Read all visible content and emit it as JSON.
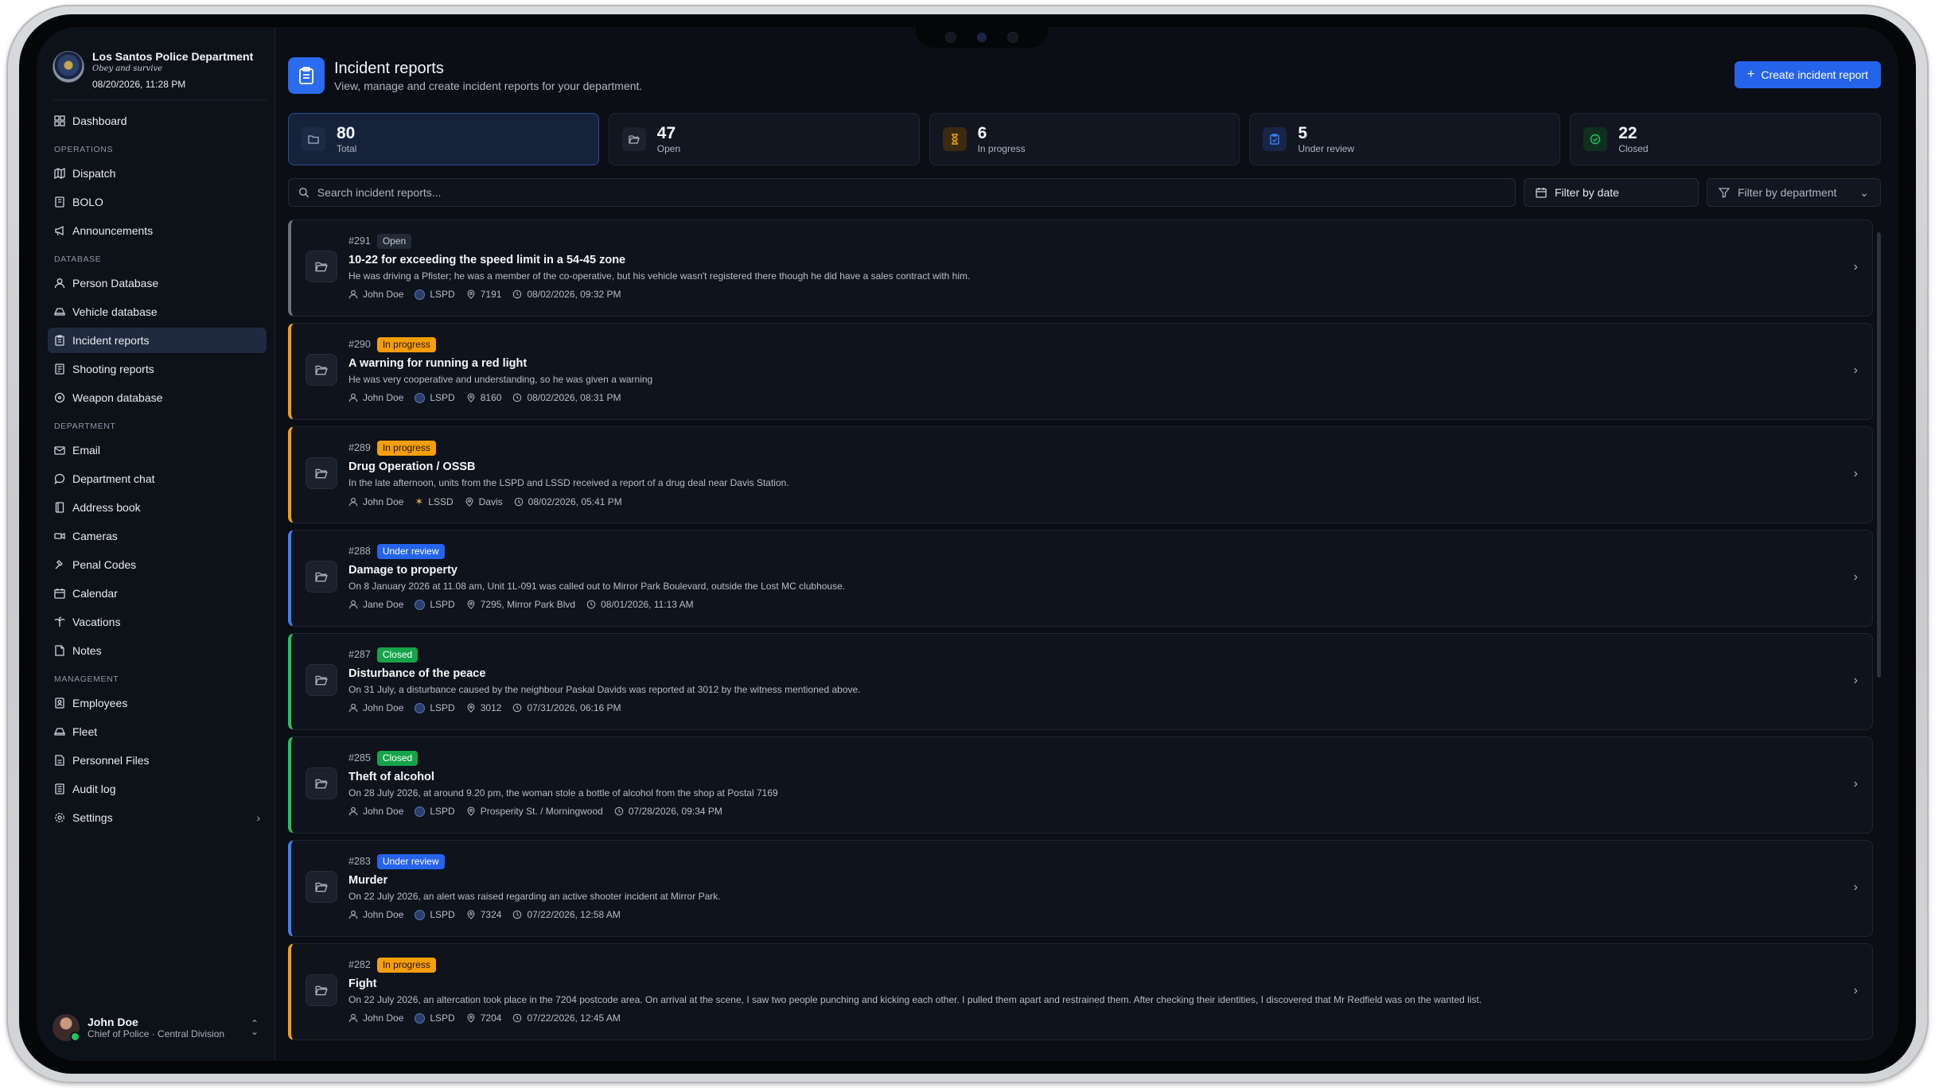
{
  "org": {
    "name": "Los Santos Police Department",
    "motto": "Obey and survive",
    "datetime": "08/20/2026, 11:28 PM"
  },
  "nav": {
    "dashboard": "Dashboard",
    "sections": {
      "operations": "OPERATIONS",
      "database": "DATABASE",
      "department": "DEPARTMENT",
      "management": "MANAGEMENT"
    },
    "operations": [
      "Dispatch",
      "BOLO",
      "Announcements"
    ],
    "database": [
      "Person Database",
      "Vehicle database",
      "Incident reports",
      "Shooting reports",
      "Weapon database"
    ],
    "department": [
      "Email",
      "Department chat",
      "Address book",
      "Cameras",
      "Penal Codes",
      "Calendar",
      "Vacations",
      "Notes"
    ],
    "management": [
      "Employees",
      "Fleet",
      "Personnel Files",
      "Audit log",
      "Settings"
    ]
  },
  "user": {
    "name": "John Doe",
    "role": "Chief of Police · Central Division"
  },
  "page": {
    "title": "Incident reports",
    "subtitle": "View, manage and create incident reports for your department.",
    "create_label": "Create incident report"
  },
  "stats": [
    {
      "value": "80",
      "label": "Total",
      "icon": "folder-icon"
    },
    {
      "value": "47",
      "label": "Open",
      "icon": "folder-open-icon"
    },
    {
      "value": "6",
      "label": "In progress",
      "icon": "hourglass-icon"
    },
    {
      "value": "5",
      "label": "Under review",
      "icon": "clipboard-icon"
    },
    {
      "value": "22",
      "label": "Closed",
      "icon": "check-circle-icon"
    }
  ],
  "filters": {
    "search_placeholder": "Search incident reports...",
    "by_date": "Filter by date",
    "by_department": "Filter by department"
  },
  "status_colors": {
    "Open": "#6b7280",
    "In progress": "#f59e0b",
    "Under review": "#3b82f6",
    "Closed": "#22c55e"
  },
  "reports": [
    {
      "num": "#291",
      "status": "Open",
      "title": "10-22 for exceeding the speed limit in a 54-45 zone",
      "desc": "He was driving a Pfister; he was a member of the co-operative, but his vehicle wasn't registered there though he did have a sales contract with him.",
      "author": "John Doe",
      "dept": "LSPD",
      "location": "7191",
      "date": "08/02/2026, 09:32 PM"
    },
    {
      "num": "#290",
      "status": "In progress",
      "title": "A warning for running a red light",
      "desc": "He was very cooperative and understanding, so he was given a warning",
      "author": "John Doe",
      "dept": "LSPD",
      "location": "8160",
      "date": "08/02/2026, 08:31 PM"
    },
    {
      "num": "#289",
      "status": "In progress",
      "title": "Drug Operation / OSSB",
      "desc": "In the late afternoon, units from the LSPD and LSSD received a report of a drug deal near Davis Station.",
      "author": "John Doe",
      "dept": "LSSD",
      "location": "Davis",
      "date": "08/02/2026, 05:41 PM"
    },
    {
      "num": "#288",
      "status": "Under review",
      "title": "Damage to property",
      "desc": "On 8 January 2026 at 11.08 am, Unit 1L-091 was called out to Mirror Park Boulevard, outside the Lost MC clubhouse.",
      "author": "Jane Doe",
      "dept": "LSPD",
      "location": "7295, Mirror Park Blvd",
      "date": "08/01/2026, 11:13 AM"
    },
    {
      "num": "#287",
      "status": "Closed",
      "title": "Disturbance of the peace",
      "desc": "On 31 July, a disturbance caused by the neighbour Paskal Davids was reported at 3012 by the witness mentioned above.",
      "author": "John Doe",
      "dept": "LSPD",
      "location": "3012",
      "date": "07/31/2026, 06:16 PM"
    },
    {
      "num": "#285",
      "status": "Closed",
      "title": "Theft of alcohol",
      "desc": "On 28 July 2026, at around 9.20 pm, the woman stole a bottle of alcohol from the shop at Postal 7169",
      "author": "John Doe",
      "dept": "LSPD",
      "location": "Prosperity St. / Morningwood",
      "date": "07/28/2026, 09:34 PM"
    },
    {
      "num": "#283",
      "status": "Under review",
      "title": "Murder",
      "desc": "On 22 July 2026, an alert was raised regarding an active shooter incident at Mirror Park.",
      "author": "John Doe",
      "dept": "LSPD",
      "location": "7324",
      "date": "07/22/2026, 12:58 AM"
    },
    {
      "num": "#282",
      "status": "In progress",
      "title": "Fight",
      "desc": "On 22 July 2026, an altercation took place in the 7204 postcode area. On arrival at the scene, I saw two people punching and kicking each other. I pulled them apart and restrained them. After checking their identities, I discovered that Mr Redfield was on the wanted list.",
      "author": "John Doe",
      "dept": "LSPD",
      "location": "7204",
      "date": "07/22/2026, 12:45 AM"
    }
  ]
}
